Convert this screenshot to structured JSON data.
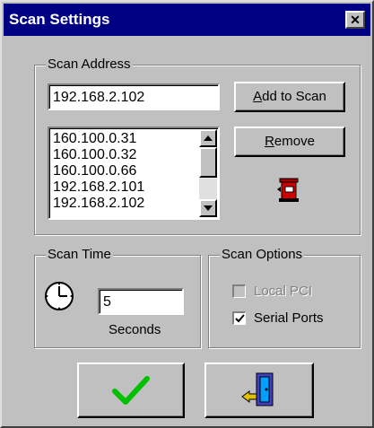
{
  "window": {
    "title": "Scan Settings",
    "close_label": "✕"
  },
  "scan_address": {
    "group_label": "Scan Address",
    "address_value": "192.168.2.102",
    "add_button_label": "Add to Scan",
    "remove_button_label": "Remove",
    "addresses": [
      "160.100.0.31",
      "160.100.0.32",
      "160.100.0.66",
      "192.168.2.101",
      "192.168.2.102"
    ]
  },
  "scan_time": {
    "group_label": "Scan Time",
    "value": "5",
    "unit_label": "Seconds"
  },
  "scan_options": {
    "group_label": "Scan Options",
    "options": [
      {
        "label": "Local PCI",
        "checked": false,
        "enabled": false
      },
      {
        "label": "Serial Ports",
        "checked": true,
        "enabled": true
      }
    ]
  },
  "icons": {
    "mailbox": "mailbox-icon",
    "clock": "clock-icon",
    "ok": "checkmark-icon",
    "exit": "exit-door-icon"
  },
  "colors": {
    "titlebar": "#000082",
    "ok_check": "#00c000",
    "mailbox_red": "#d00000"
  }
}
